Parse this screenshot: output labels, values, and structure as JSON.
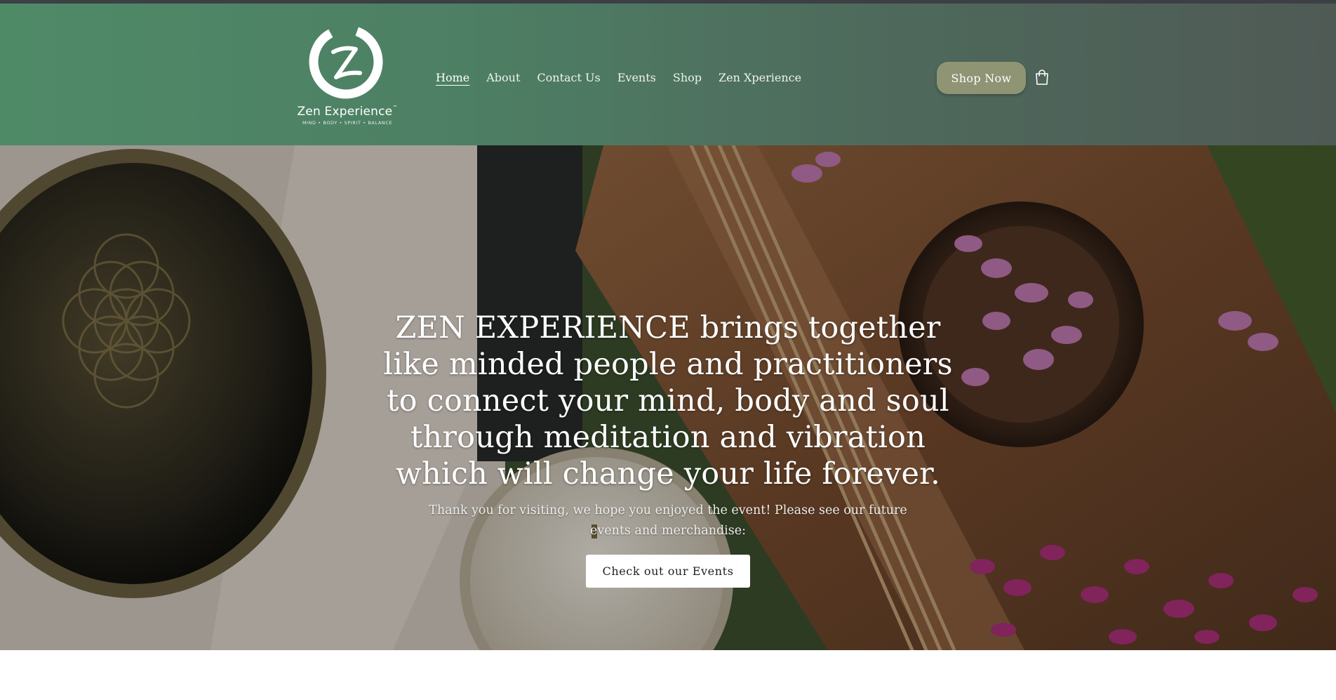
{
  "brand": {
    "name": "Zen Experience",
    "trademark": "™",
    "tagline": "MIND • BODY • SPIRIT • BALANCE"
  },
  "nav": {
    "items": [
      {
        "label": "Home",
        "active": true
      },
      {
        "label": "About"
      },
      {
        "label": "Contact Us"
      },
      {
        "label": "Events"
      },
      {
        "label": "Shop"
      },
      {
        "label": "Zen Xperience"
      }
    ]
  },
  "header": {
    "shop_now_label": "Shop Now",
    "cart_icon": "shopping-bag-icon"
  },
  "hero": {
    "heading": "ZEN EXPERIENCE brings together like minded people and practitioners to connect your mind, body and soul through meditation and vibration which will change your life forever.",
    "subtext": "Thank you for visiting, we hope you enjoyed the event! Please see our future events and merchandise:",
    "cta_label": "Check out our Events"
  },
  "colors": {
    "header_green": "#4f8a67",
    "header_gray": "#4f5a55",
    "shop_button": "#8f9474",
    "cta_background": "#ffffff"
  }
}
